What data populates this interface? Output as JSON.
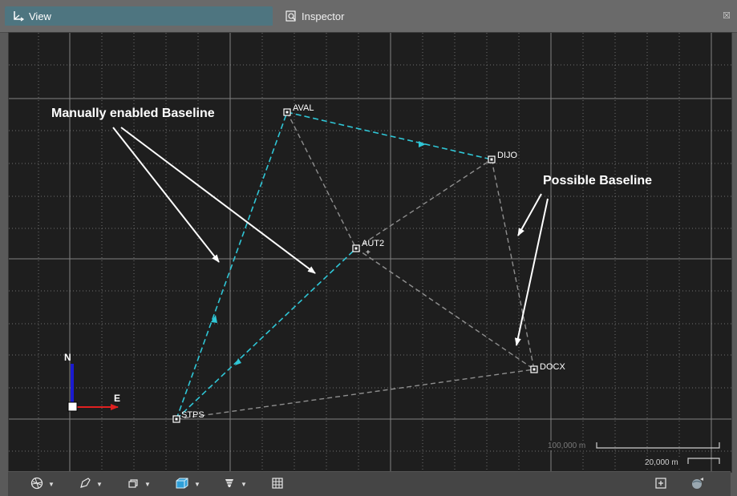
{
  "tabs": [
    {
      "label": "View",
      "icon": "axes-icon"
    },
    {
      "label": "Inspector",
      "icon": "inspector-icon"
    }
  ],
  "close_glyph": "☒",
  "map": {
    "stations": [
      {
        "name": "AVAL"
      },
      {
        "name": "DIJO"
      },
      {
        "name": "AUT2"
      },
      {
        "name": "DOCX"
      },
      {
        "name": "STPS"
      }
    ],
    "annotations": {
      "manual": "Manually enabled Baseline",
      "possible": "Possible Baseline"
    },
    "compass": {
      "north": "N",
      "east": "E"
    },
    "scale_bar_1": "100,000 m",
    "scale_bar_2": "20,000 m",
    "baseline_colors": {
      "manual": "#2fc6d6",
      "possible": "#8a8a8a"
    }
  },
  "toolbar": {
    "buttons": [
      {
        "icon": "globe-icon"
      },
      {
        "icon": "draw-icon"
      },
      {
        "icon": "layers-icon"
      },
      {
        "icon": "cube-icon"
      },
      {
        "icon": "filter-icon"
      },
      {
        "icon": "grid-icon"
      }
    ],
    "right_buttons": [
      {
        "icon": "zoom-extent-icon"
      },
      {
        "icon": "satellite-icon"
      }
    ]
  }
}
